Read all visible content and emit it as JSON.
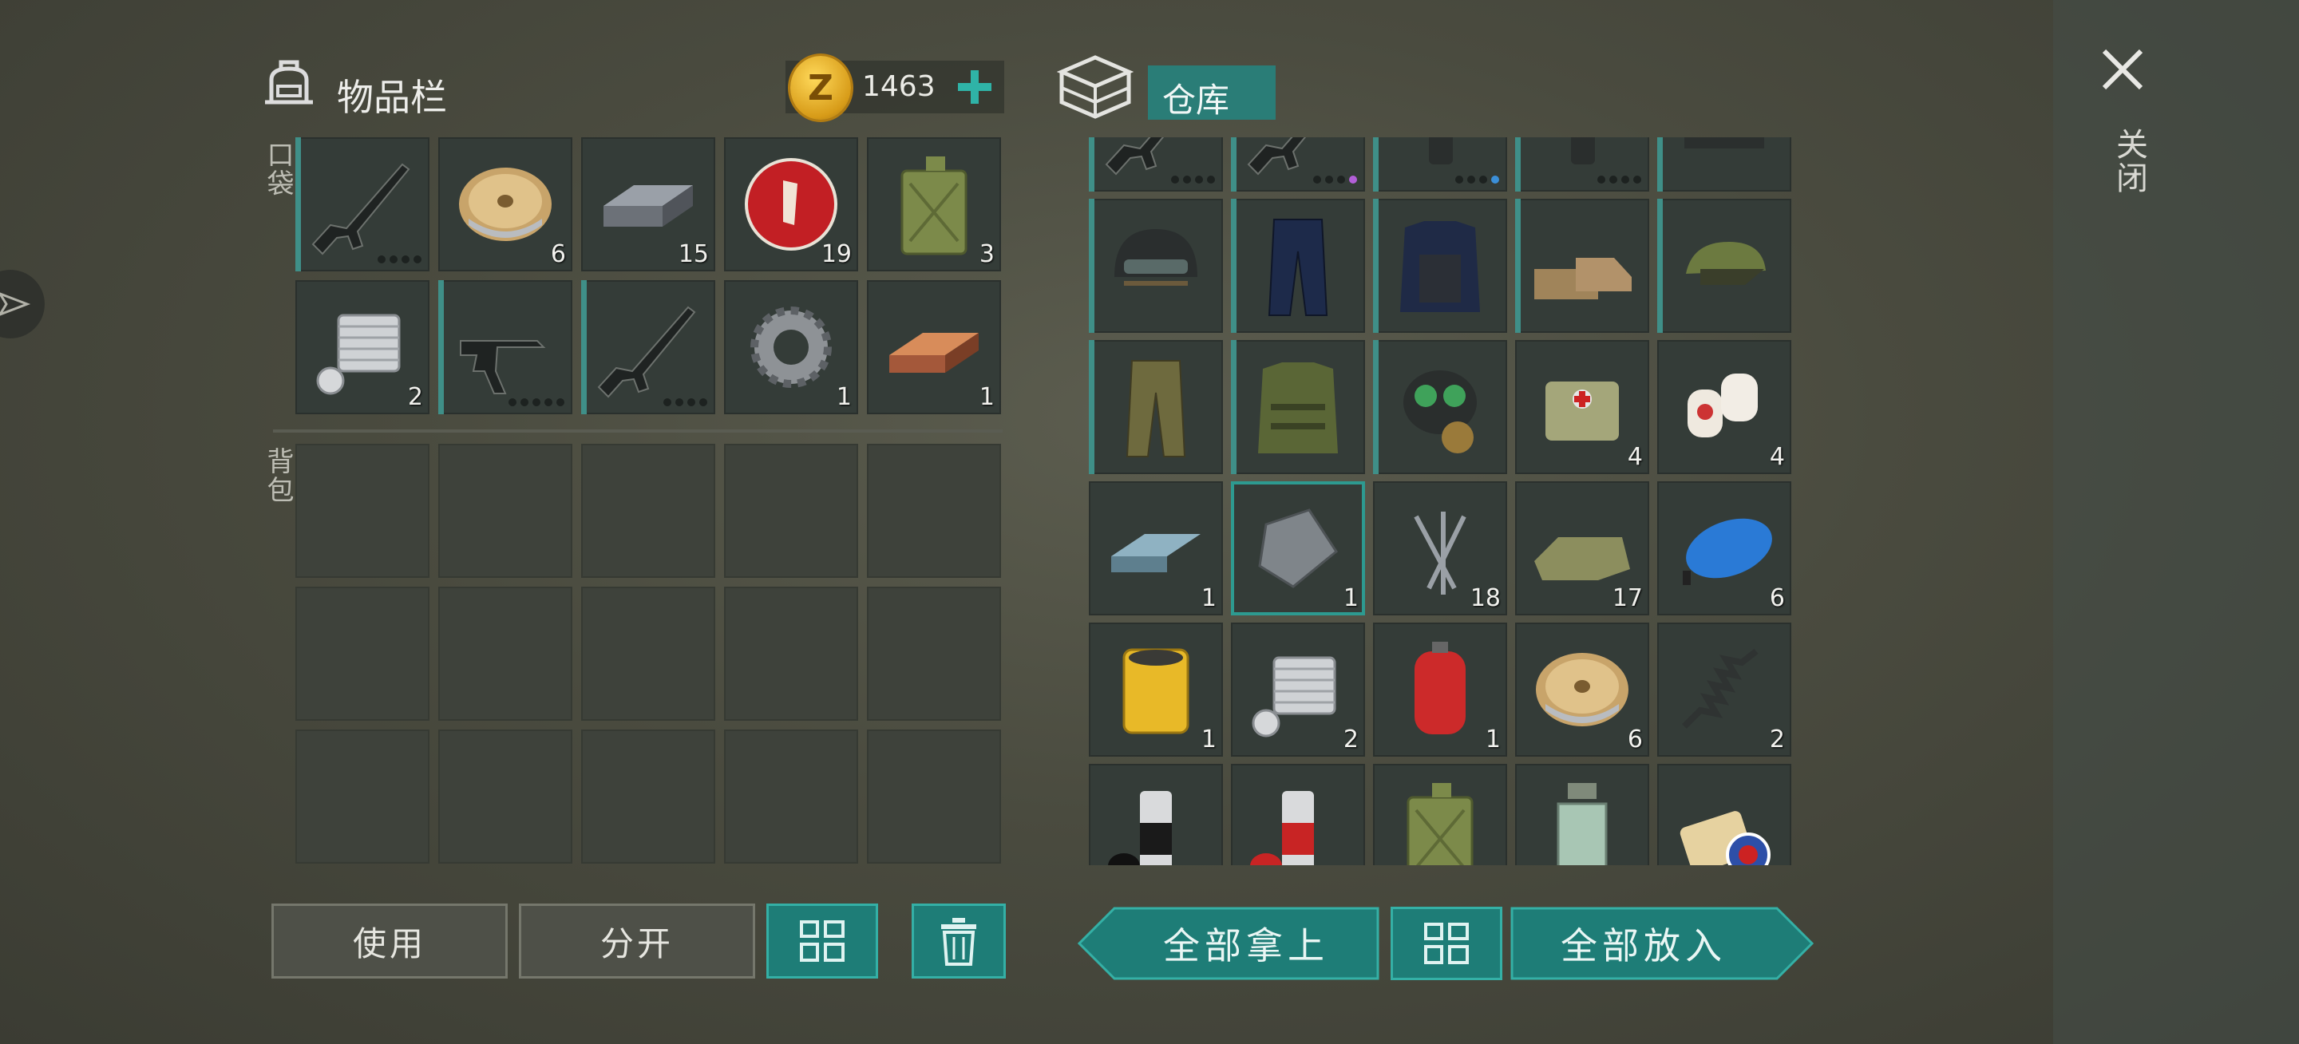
{
  "inventory": {
    "title": "物品栏",
    "coins": "1463",
    "pocket_label": "口袋",
    "backpack_label": "背包",
    "pocket_slots": [
      {
        "item": "assault-rifle",
        "count": "",
        "dots": 4
      },
      {
        "item": "wire-spool",
        "count": "6"
      },
      {
        "item": "steel-bar",
        "count": "15"
      },
      {
        "item": "bottle-cap",
        "count": "19"
      },
      {
        "item": "jerrycan",
        "count": "3"
      },
      {
        "item": "engine-cylinder",
        "count": "2"
      },
      {
        "item": "uzi",
        "count": "",
        "dots": 5
      },
      {
        "item": "assault-rifle",
        "count": "",
        "dots": 4
      },
      {
        "item": "gear",
        "count": "1"
      },
      {
        "item": "copper-bar",
        "count": "1"
      }
    ]
  },
  "storage": {
    "title": "仓库",
    "slots": [
      {
        "item": "rifle",
        "count": "",
        "dots": "4"
      },
      {
        "item": "rifle",
        "count": "",
        "dots": "3p"
      },
      {
        "item": "mag",
        "count": "",
        "dots": "3b"
      },
      {
        "item": "mag",
        "count": "",
        "dots": "4"
      },
      {
        "item": "boots",
        "count": ""
      },
      {
        "item": "helmet",
        "count": ""
      },
      {
        "item": "police-pants",
        "count": ""
      },
      {
        "item": "police-vest",
        "count": ""
      },
      {
        "item": "work-boots",
        "count": ""
      },
      {
        "item": "camo-cap",
        "count": ""
      },
      {
        "item": "camo-pants",
        "count": ""
      },
      {
        "item": "camo-vest",
        "count": ""
      },
      {
        "item": "gas-mask",
        "count": ""
      },
      {
        "item": "medkit-bag",
        "count": "4"
      },
      {
        "item": "bandage",
        "count": "4"
      },
      {
        "item": "aluminum-bar",
        "count": "1"
      },
      {
        "item": "metal-plate",
        "count": "1"
      },
      {
        "item": "nails",
        "count": "18"
      },
      {
        "item": "cloth",
        "count": "17"
      },
      {
        "item": "fuel-tank",
        "count": "6"
      },
      {
        "item": "oil-filter",
        "count": "1"
      },
      {
        "item": "engine-cylinder",
        "count": "2"
      },
      {
        "item": "gas-cylinder",
        "count": "1"
      },
      {
        "item": "wire-spool",
        "count": "6"
      },
      {
        "item": "spring",
        "count": "2"
      },
      {
        "item": "spray-paint-black",
        "count": ""
      },
      {
        "item": "spray-paint-red",
        "count": ""
      },
      {
        "item": "jerrycan",
        "count": ""
      },
      {
        "item": "bottle",
        "count": ""
      },
      {
        "item": "badges",
        "count": ""
      }
    ]
  },
  "buttons": {
    "use": "使用",
    "split": "分开",
    "take_all": "全部拿上",
    "put_all": "全部放入"
  },
  "close_label": "关闭"
}
